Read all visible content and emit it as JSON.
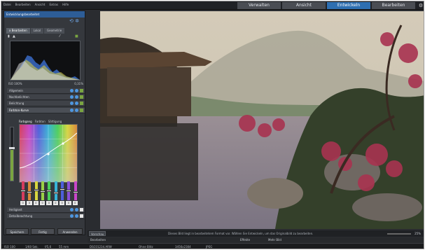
{
  "menubar": {
    "items": [
      "Datei",
      "Bearbeiten",
      "Ansicht",
      "Extras",
      "Hilfe"
    ]
  },
  "modes": {
    "tabs": [
      {
        "label": "Verwalten",
        "active": false
      },
      {
        "label": "Ansicht",
        "active": false
      },
      {
        "label": "Entwickeln",
        "active": true
      },
      {
        "label": "Bearbeiten",
        "active": false
      }
    ],
    "settings_icon": "gear-icon"
  },
  "panel": {
    "header": "Entwicklungsbearbeitet",
    "tabs": [
      {
        "label": "x Bearbeiten",
        "active": true
      },
      {
        "label": "Lokal",
        "active": false
      },
      {
        "label": "Geometrie",
        "active": false
      }
    ],
    "stat_left": "ISO 100%",
    "stat_right": "0,31%",
    "sections": [
      {
        "label": "Allgemein"
      },
      {
        "label": "Nachbelichten"
      },
      {
        "label": "Belichtung"
      },
      {
        "label": "Farbton-Kurve",
        "open": true
      },
      {
        "label": "Helligkeit"
      },
      {
        "label": "Detailbeachtung"
      }
    ],
    "curve_tabs": [
      {
        "label": "Farbgang",
        "active": true
      },
      {
        "label": "Farbton",
        "active": false
      },
      {
        "label": "Sättigung",
        "active": false
      }
    ],
    "slider_values": [
      "0",
      "0",
      "0",
      "0",
      "0",
      "0",
      "0",
      "0",
      "0",
      "0"
    ],
    "buttons": {
      "save": "Speichern",
      "done": "Fertig",
      "apply": "Anwenden"
    }
  },
  "filmstrip": {
    "label": "Vorschau",
    "message": "Dieses Bild liegt in bearbeitetem Format vor. Wählen Sie Entwickeln, um das Originalbild zu bearbeiten.",
    "zoom": "25%"
  },
  "subbar": {
    "left": "Bearbeiten",
    "mid": "Effekte",
    "right": "Mehr Bild"
  },
  "status": {
    "items": [
      "ISO 100",
      "1/60 Sek.",
      "f/5,6",
      "55 mm",
      "DSC01234.ARW",
      "Ohne Blitz",
      "3456x2304",
      "JPEG"
    ]
  },
  "colors": {
    "accent": "#2e6fb1",
    "panel_header": "#2d5d97",
    "section_dot": "#4e97e0",
    "section_square": "#7aa541"
  }
}
